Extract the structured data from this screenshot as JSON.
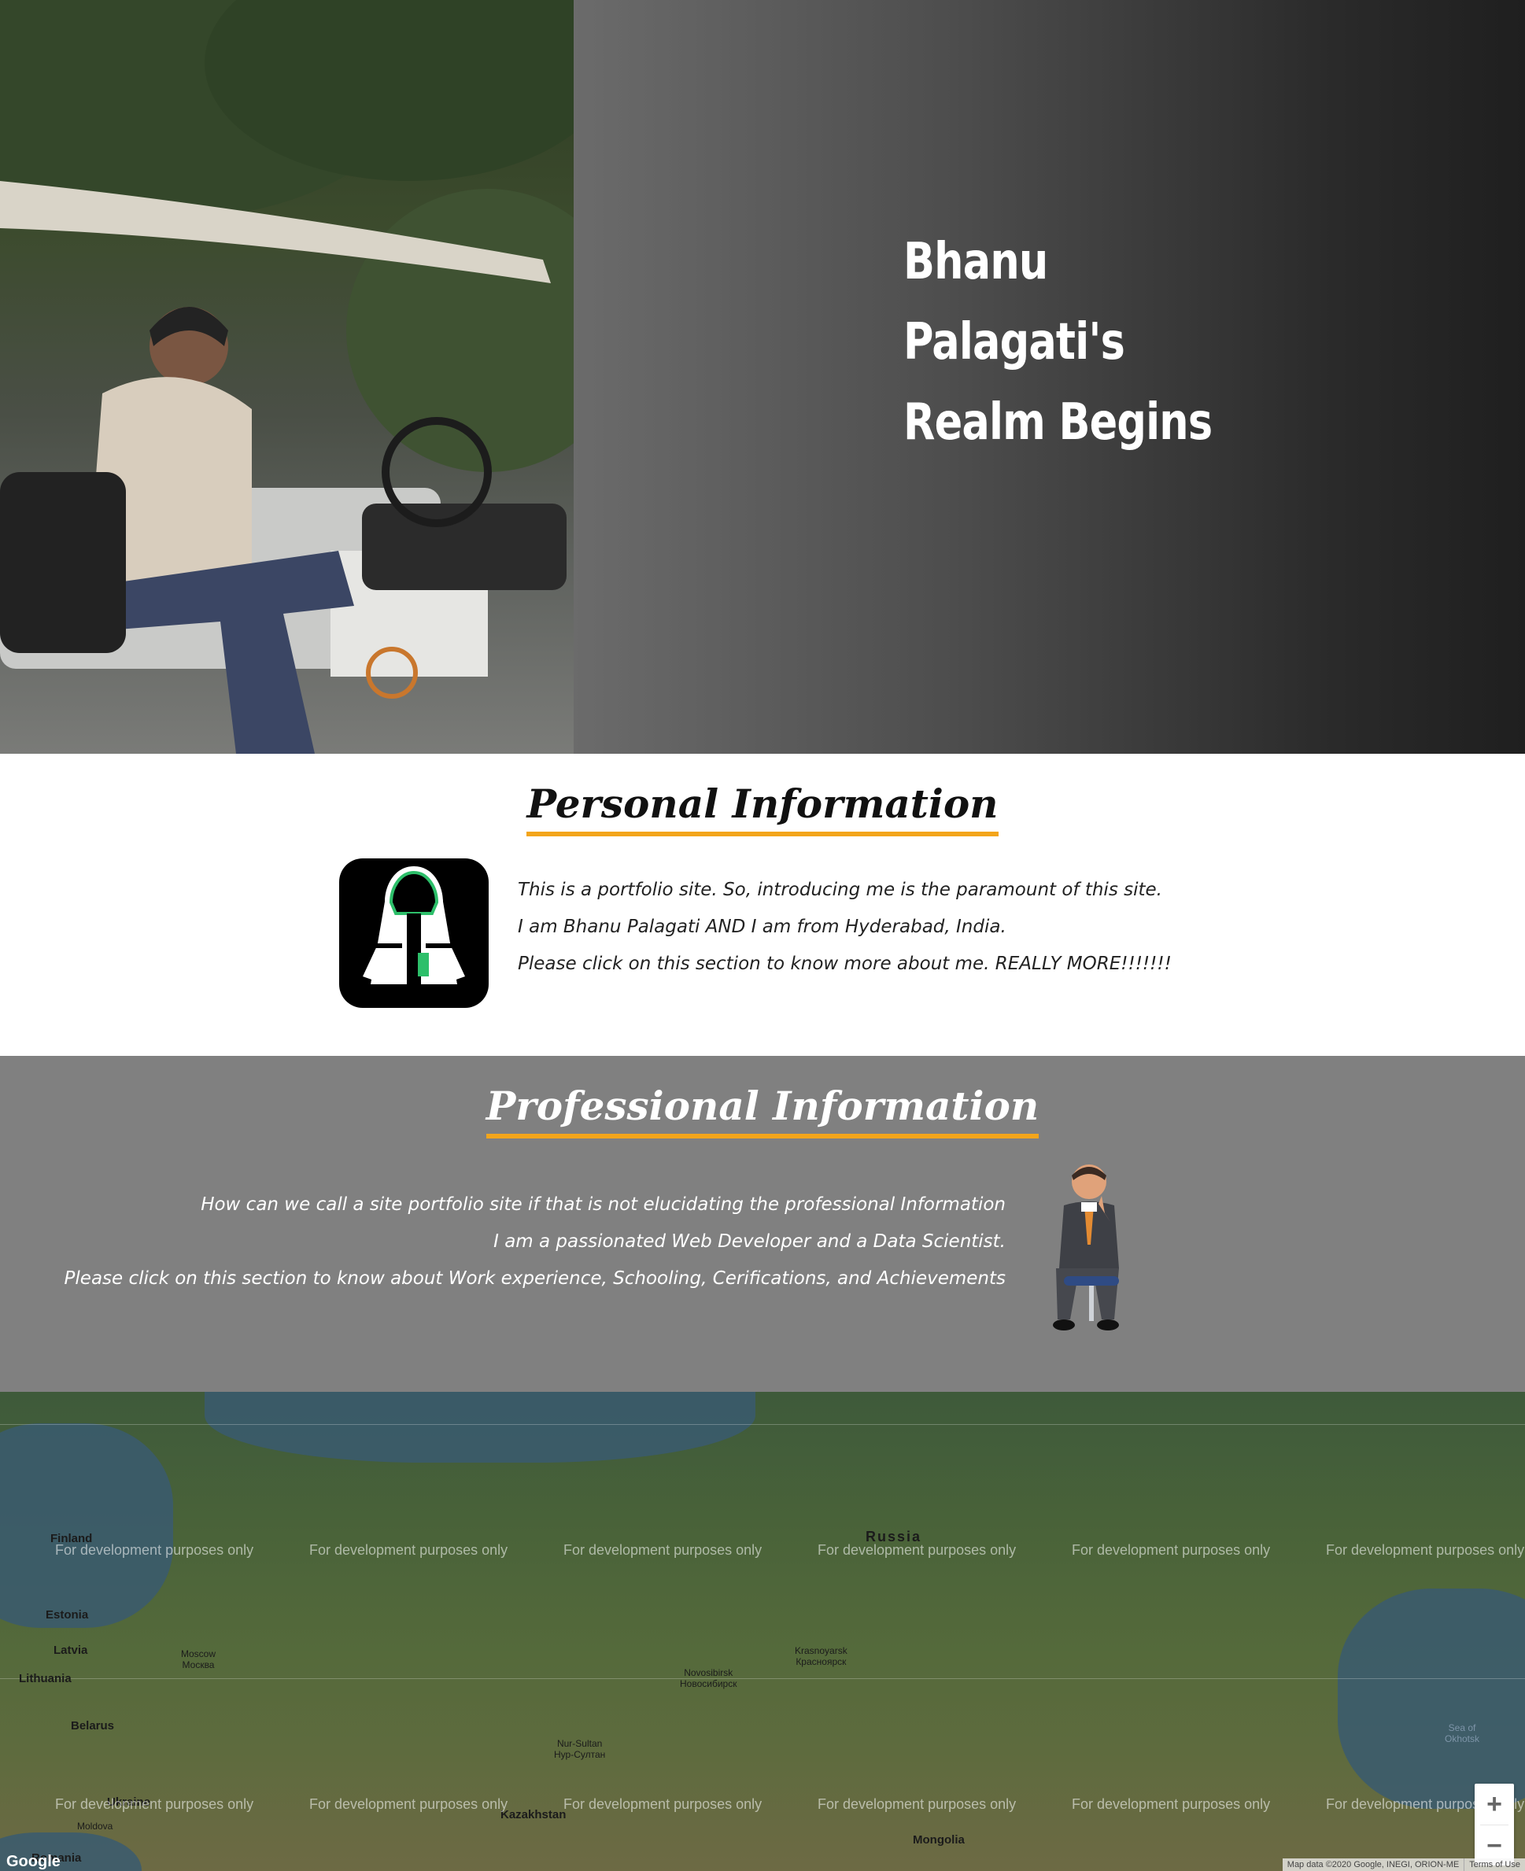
{
  "hero": {
    "title_lines": [
      "Bhanu",
      "Palagati's",
      "Realm Begins"
    ]
  },
  "personal": {
    "heading": "Personal Information",
    "lines": [
      "This is a portfolio site. So, introducing me is the paramount of this site.",
      "I am Bhanu Palagati AND I am from Hyderabad, India.",
      "Please click on this section to know more about me. REALLY MORE!!!!!!!"
    ]
  },
  "professional": {
    "heading": "Professional Information",
    "lines": [
      "How can we call a site portfolio site if that is not elucidating the professional Information",
      "I am a passionated Web Developer and a Data Scientist.",
      "Please click on this section to know about Work experience, Schooling, Cerifications, and Achievements"
    ]
  },
  "map": {
    "watermark": "For development purposes only",
    "labels": {
      "finland": "Finland",
      "russia": "Russia",
      "estonia": "Estonia",
      "latvia": "Latvia",
      "lithuania": "Lithuania",
      "belarus": "Belarus",
      "moscow": "Moscow",
      "moscow_ru": "Москва",
      "novosibirsk": "Novosibirsk",
      "novosibirsk_ru": "Новосибирск",
      "krasnoyarsk": "Krasnoyarsk",
      "krasnoyarsk_ru": "Красноярск",
      "nur_sultan": "Nur-Sultan",
      "nur_sultan_ru": "Нур-Султан",
      "kazakhstan": "Kazakhstan",
      "mongolia": "Mongolia",
      "moldova": "Moldova",
      "romania": "Romania",
      "ukraine": "Ukraine",
      "sea_okhotsk": "Sea of",
      "sea_okhotsk_2": "Okhotsk"
    },
    "zoom_in": "+",
    "zoom_out": "−",
    "google": "Google",
    "attribution": "Map data ©2020 Google, INEGI, ORION-ME",
    "terms": "Terms of Use"
  }
}
